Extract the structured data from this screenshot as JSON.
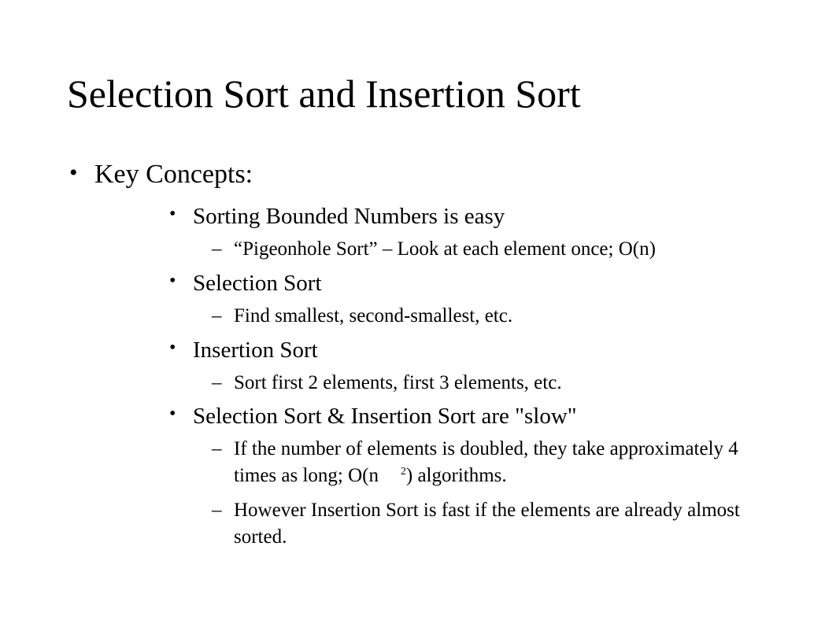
{
  "title": "Selection Sort and Insertion Sort",
  "bullets": {
    "l1_0": "Key Concepts:",
    "l2_0": "Sorting Bounded Numbers is easy",
    "l3_0": "“Pigeonhole Sort” – Look at each element once; O(n)",
    "l2_1": "Selection Sort",
    "l3_1": "Find smallest, second-smallest, etc.",
    "l2_2": "Insertion Sort",
    "l3_2": "Sort first 2 elements, first 3 elements, etc.",
    "l2_3": "Selection Sort & Insertion Sort are \"slow\"",
    "l3_3_pre": "If the number of elements is doubled, they take approximately 4 times as long; O(n",
    "l3_3_sup": "2",
    "l3_3_post": ") algorithms.",
    "l3_4": "However Insertion Sort is fast if the elements are already almost sorted."
  }
}
